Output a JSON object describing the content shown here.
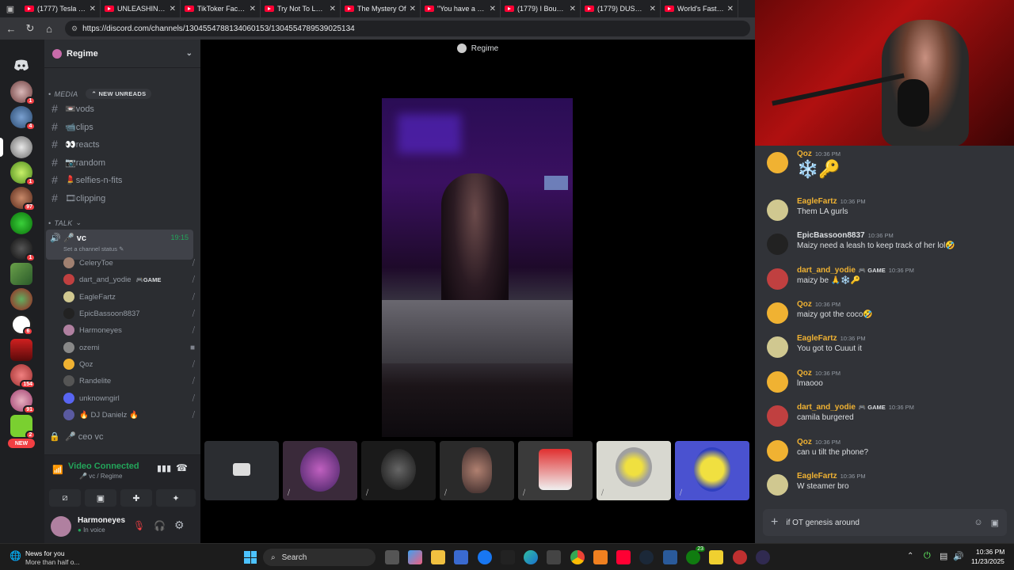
{
  "browser": {
    "tabs": [
      "(1777) Tesla Glue",
      "UNLEASHING on",
      "TikToker Facing",
      "Try Not To Laugh",
      "The Mystery Of",
      "\"You have a right",
      "(1779) I Bought",
      "(1779) DUST - Yo",
      "World's Fastest"
    ],
    "url": "https://discord.com/channels/1304554788134060153/1304554789539025134"
  },
  "servers": {
    "badges": [
      "1",
      "4",
      "1",
      "97",
      "1",
      "6",
      "154",
      "91",
      "2"
    ],
    "new_label": "NEW"
  },
  "sidebar": {
    "guild_name": "Regime",
    "media_category": "MEDIA",
    "new_unreads": "NEW UNREADS",
    "channels": [
      "📼vods",
      "📹clips",
      "👀reacts",
      "📷random",
      "💄selfies-n-fits",
      "🎞clipping"
    ],
    "talk_category": "TALK",
    "vc_name": "vc",
    "vc_status": "Set a channel status",
    "vc_time": "19:15",
    "members": [
      "CeleryToe",
      "dart_and_yodie",
      "EagleFartz",
      "EpicBassoon8837",
      "Harmoneyes",
      "ozemi",
      "Qoz",
      "Randelite",
      "unknowngirl",
      "DJ Danielz"
    ],
    "game_tag": "GAME",
    "ceo_vc": "ceo vc"
  },
  "voice_panel": {
    "status": "Video Connected",
    "location": "vc / Regime"
  },
  "user_panel": {
    "username": "Harmoneyes",
    "status": "In voice"
  },
  "stage": {
    "title": "Regime"
  },
  "chat": {
    "messages": [
      {
        "author": "Qoz",
        "time": "10:36 PM",
        "text": "❄️🔑",
        "color": "#f0b232",
        "game": ""
      },
      {
        "author": "EagleFartz",
        "time": "10:36 PM",
        "text": "Them LA gurls",
        "color": "#f0b232",
        "game": ""
      },
      {
        "author": "EpicBassoon8837",
        "time": "10:36 PM",
        "text": "Maizy need a leash to keep track of her lol🤣",
        "color": "#dbdee1",
        "game": ""
      },
      {
        "author": "dart_and_yodie",
        "time": "10:36 PM",
        "text": "maizy be 🙏❄️🔑",
        "color": "#f0b232",
        "game": "GAME"
      },
      {
        "author": "Qoz",
        "time": "10:36 PM",
        "text": "maizy got the coco🤣",
        "color": "#f0b232",
        "game": ""
      },
      {
        "author": "EagleFartz",
        "time": "10:36 PM",
        "text": "You got to Cuuut it",
        "color": "#f0b232",
        "game": ""
      },
      {
        "author": "Qoz",
        "time": "10:36 PM",
        "text": "lmaooo",
        "color": "#f0b232",
        "game": ""
      },
      {
        "author": "dart_and_yodie",
        "time": "10:36 PM",
        "text": "camila burgered",
        "color": "#f0b232",
        "game": "GAME"
      },
      {
        "author": "Qoz",
        "time": "10:36 PM",
        "text": "can u tilt the phone?",
        "color": "#f0b232",
        "game": ""
      },
      {
        "author": "EagleFartz",
        "time": "10:36 PM",
        "text": "W steamer bro",
        "color": "#f0b232",
        "game": ""
      }
    ],
    "input_value": "if OT genesis around"
  },
  "taskbar": {
    "news_title": "News for you",
    "news_sub": "More than half o...",
    "search_label": "Search",
    "time": "10:36 PM",
    "date": "11/23/2025",
    "xbox_badge": "23"
  },
  "colors": {
    "accent": "#5865f2",
    "name_gold": "#f0b232",
    "connected_green": "#23a55a"
  }
}
